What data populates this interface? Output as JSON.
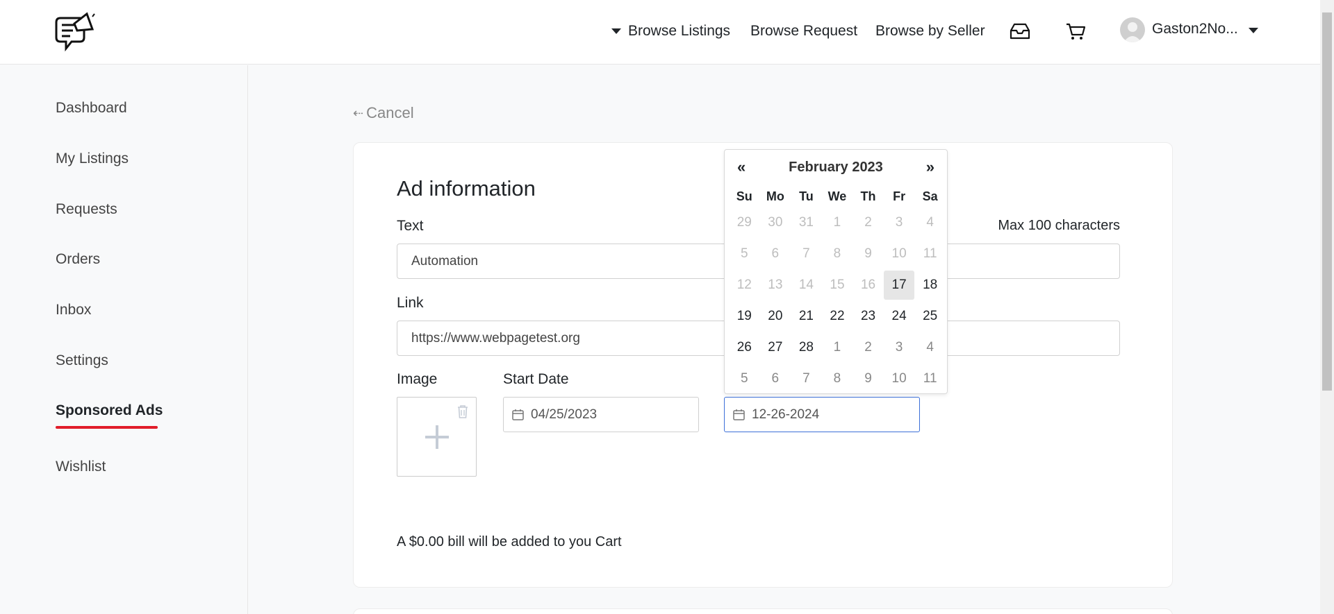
{
  "header": {
    "nav": {
      "browse_listings": "Browse Listings",
      "browse_request": "Browse Request",
      "browse_by_seller": "Browse by Seller"
    },
    "user": {
      "name": "Gaston2No..."
    }
  },
  "sidebar": {
    "items": [
      {
        "label": "Dashboard"
      },
      {
        "label": "My Listings"
      },
      {
        "label": "Requests"
      },
      {
        "label": "Orders"
      },
      {
        "label": "Inbox"
      },
      {
        "label": "Settings"
      },
      {
        "label": "Sponsored Ads",
        "active": true
      },
      {
        "label": "Wishlist"
      }
    ]
  },
  "main": {
    "cancel": "Cancel",
    "title": "Ad information",
    "text_label": "Text",
    "max_chars": "Max 100 characters",
    "text_value": "Automation",
    "link_label": "Link",
    "link_value": "https://www.webpagetest.org",
    "image_label": "Image",
    "start_date_label": "Start Date",
    "start_date_value": "04/25/2023",
    "end_date_value": "12-26-2024",
    "bill_text": "A $0.00 bill will be added to you Cart"
  },
  "datepicker": {
    "prev": "«",
    "next": "»",
    "title": "February 2023",
    "weekdays": [
      "Su",
      "Mo",
      "Tu",
      "We",
      "Th",
      "Fr",
      "Sa"
    ],
    "weeks": [
      [
        "29",
        "30",
        "31",
        "1",
        "2",
        "3",
        "4"
      ],
      [
        "5",
        "6",
        "7",
        "8",
        "9",
        "10",
        "11"
      ],
      [
        "12",
        "13",
        "14",
        "15",
        "16",
        "17",
        "18"
      ],
      [
        "19",
        "20",
        "21",
        "22",
        "23",
        "24",
        "25"
      ],
      [
        "26",
        "27",
        "28",
        "1",
        "2",
        "3",
        "4"
      ],
      [
        "5",
        "6",
        "7",
        "8",
        "9",
        "10",
        "11"
      ]
    ],
    "highlighted": "17",
    "colors": {
      "disabled": "#bdbdbd",
      "other_month": "#888888",
      "today_bg": "#e6e6e6"
    }
  },
  "colors": {
    "accent_underline": "#e11d2a",
    "focus_border": "#3b6fd8"
  }
}
